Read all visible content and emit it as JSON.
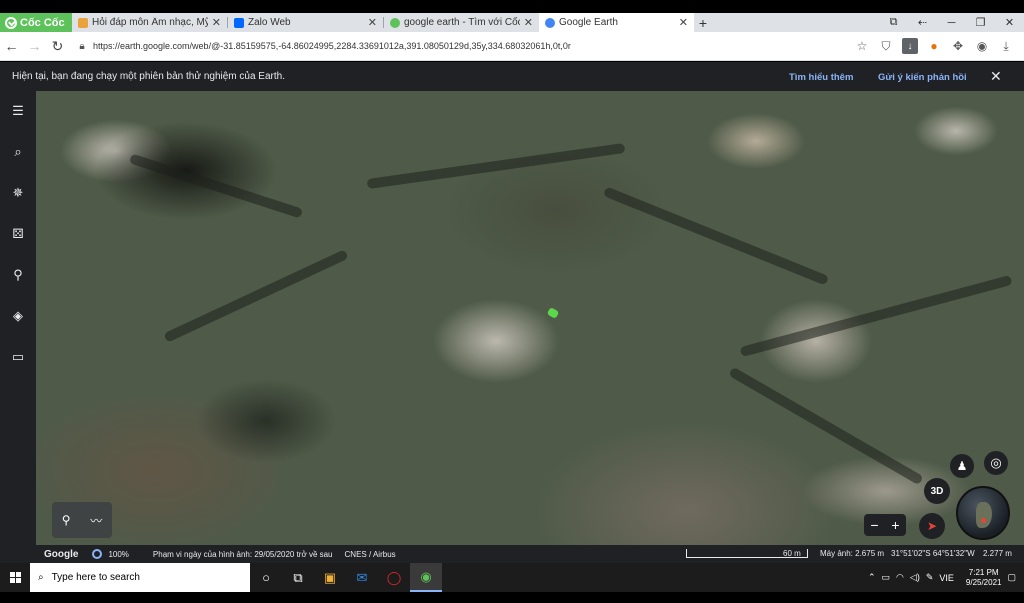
{
  "browser": {
    "brand": "Cốc Cốc",
    "tabs": [
      {
        "label": "Hỏi đáp môn Âm nhạc, Mỹ thuật",
        "icon": "hoidap-icon",
        "color": "#e8a33d"
      },
      {
        "label": "Zalo Web",
        "icon": "zalo-icon",
        "color": "#0068ff"
      },
      {
        "label": "google earth - Tìm với Cốc Cốc",
        "icon": "coccoc-search-icon",
        "color": "#5ec25a"
      },
      {
        "label": "Google Earth",
        "icon": "google-earth-icon",
        "color": "#4285f4"
      }
    ],
    "active_tab_index": 3,
    "url": "https://earth.google.com/web/@-31.85159575,-64.86024995,2284.33691012a,391.08050129d,35y,334.68032061h,0t,0r"
  },
  "notice": {
    "text": "Hiện tại, bạn đang chạy một phiên bản thử nghiệm của Earth.",
    "learn_more": "Tìm hiểu thêm",
    "feedback": "Gửi ý kiến phản hồi"
  },
  "map_controls": {
    "three_d": "3D"
  },
  "status": {
    "brand": "Google",
    "percent": "100%",
    "imagery_date": "Phạm vi ngày của hình ảnh: 29/05/2020 trở về sau",
    "source": "CNES / Airbus",
    "scale": "60 m",
    "camera": "Máy ảnh: 2.675 m",
    "coords": "31°51'02\"S 64°51'32\"W",
    "elevation": "2.277 m"
  },
  "taskbar": {
    "search_placeholder": "Type here to search",
    "lang": "VIE",
    "time": "7:21 PM",
    "date": "9/25/2021"
  }
}
